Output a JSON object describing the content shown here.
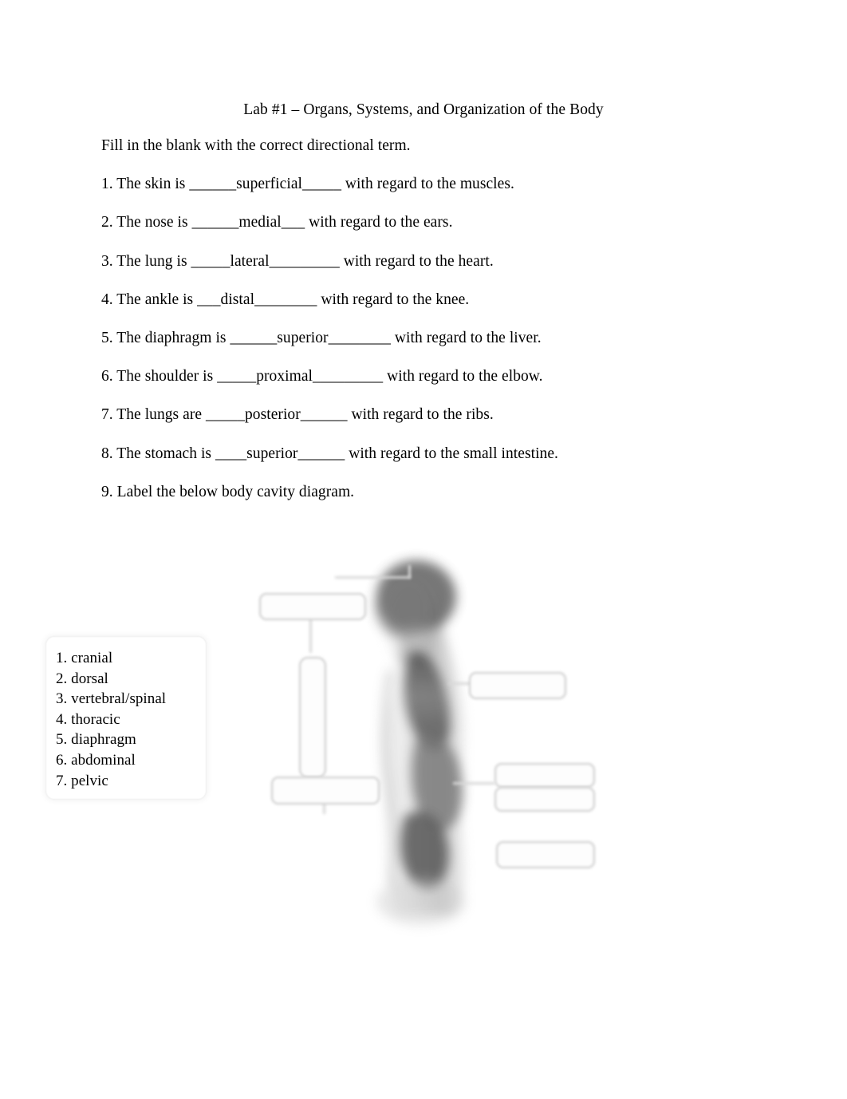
{
  "document": {
    "title": "Lab #1 – Organs, Systems, and Organization of the Body",
    "instruction": "Fill in the blank with the correct directional term.",
    "questions": [
      "1. The skin is ______superficial_____ with regard to the muscles.",
      "2. The nose is ______medial___ with regard to the ears.",
      "3. The lung is _____lateral_________ with regard to the heart.",
      "4. The ankle is ___distal________ with regard to the knee.",
      "5. The diaphragm is ______superior________ with regard to the liver.",
      "6. The shoulder is _____proximal_________ with regard to the elbow.",
      "7. The lungs are _____posterior______ with regard to the ribs.",
      "8. The stomach is ____superior______ with regard to the small intestine.",
      "9. Label the below body cavity diagram."
    ]
  },
  "answer_key": {
    "items": [
      "1. cranial",
      "2. dorsal",
      "3. vertebral/spinal",
      "4. thoracic",
      "5. diaphragm",
      "6. abdominal",
      "7. pelvic"
    ]
  },
  "diagram": {
    "caption": "body-cavity-diagram",
    "label_boxes": [
      {
        "id": "box-top-left",
        "value": ""
      },
      {
        "id": "box-left-vertical",
        "value": ""
      },
      {
        "id": "box-lower-left",
        "value": ""
      },
      {
        "id": "box-right-upper",
        "value": ""
      },
      {
        "id": "box-right-mid-upper",
        "value": ""
      },
      {
        "id": "box-right-mid-lower",
        "value": ""
      },
      {
        "id": "box-right-bottom",
        "value": ""
      }
    ]
  },
  "colors": {
    "page_background": "#ffffff",
    "text": "#000000",
    "box_outline": "#c9c9c9",
    "card_outline": "#ececec",
    "silhouette_dark": "#4a4a4a",
    "silhouette_mid": "#7d7d7d",
    "silhouette_light": "#bcbcbc"
  }
}
